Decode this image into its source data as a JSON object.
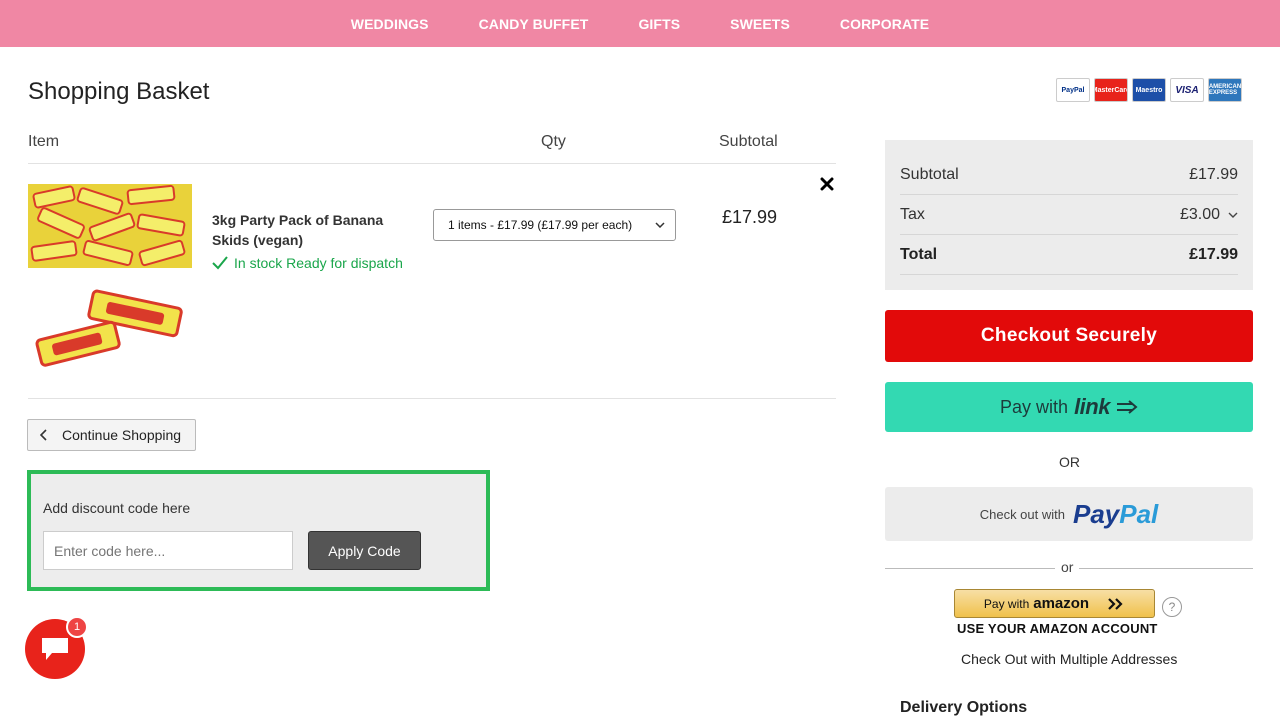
{
  "nav": {
    "items": [
      "WEDDINGS",
      "CANDY BUFFET",
      "GIFTS",
      "SWEETS",
      "CORPORATE"
    ]
  },
  "page": {
    "title": "Shopping Basket"
  },
  "payment_cards": [
    {
      "name": "PayPal",
      "label": "PayPal"
    },
    {
      "name": "mastercard",
      "label": "MasterCard"
    },
    {
      "name": "maestro",
      "label": "Maestro"
    },
    {
      "name": "visa",
      "label": "VISA"
    },
    {
      "name": "amex",
      "label": "AMERICAN EXPRESS"
    }
  ],
  "table": {
    "headers": {
      "item": "Item",
      "qty": "Qty",
      "subtotal": "Subtotal"
    },
    "rows": [
      {
        "name": "3kg Party Pack of Banana Skids (vegan)",
        "stock": "In stock Ready for dispatch",
        "qty_selected": "1 items - £17.99 (£17.99 per each)",
        "subtotal": "£17.99"
      }
    ]
  },
  "continue_label": "Continue Shopping",
  "discount": {
    "label": "Add discount code here",
    "placeholder": "Enter code here...",
    "apply_label": "Apply Code"
  },
  "chat": {
    "badge": "1"
  },
  "summary": {
    "subtotal_label": "Subtotal",
    "subtotal_value": "£17.99",
    "tax_label": "Tax",
    "tax_value": "£3.00",
    "total_label": "Total",
    "total_value": "£17.99"
  },
  "checkout": {
    "secure_label": "Checkout Securely",
    "link_pre": "Pay with",
    "link_word": "link",
    "or_label": "OR",
    "paypal_pre": "Check out with",
    "paypal_a": "Pay",
    "paypal_b": "Pal",
    "or_small": "or",
    "amazon_pre": "Pay with",
    "amazon_word": "amazon",
    "amazon_caption": "USE YOUR AMAZON ACCOUNT",
    "multi_address": "Check Out with Multiple Addresses",
    "delivery_heading": "Delivery Options"
  },
  "colors": {
    "nav": "#f087a4",
    "checkout": "#e20a0a",
    "link": "#33d9b2",
    "stock": "#1aa64b",
    "discount_border": "#2dbb57"
  }
}
